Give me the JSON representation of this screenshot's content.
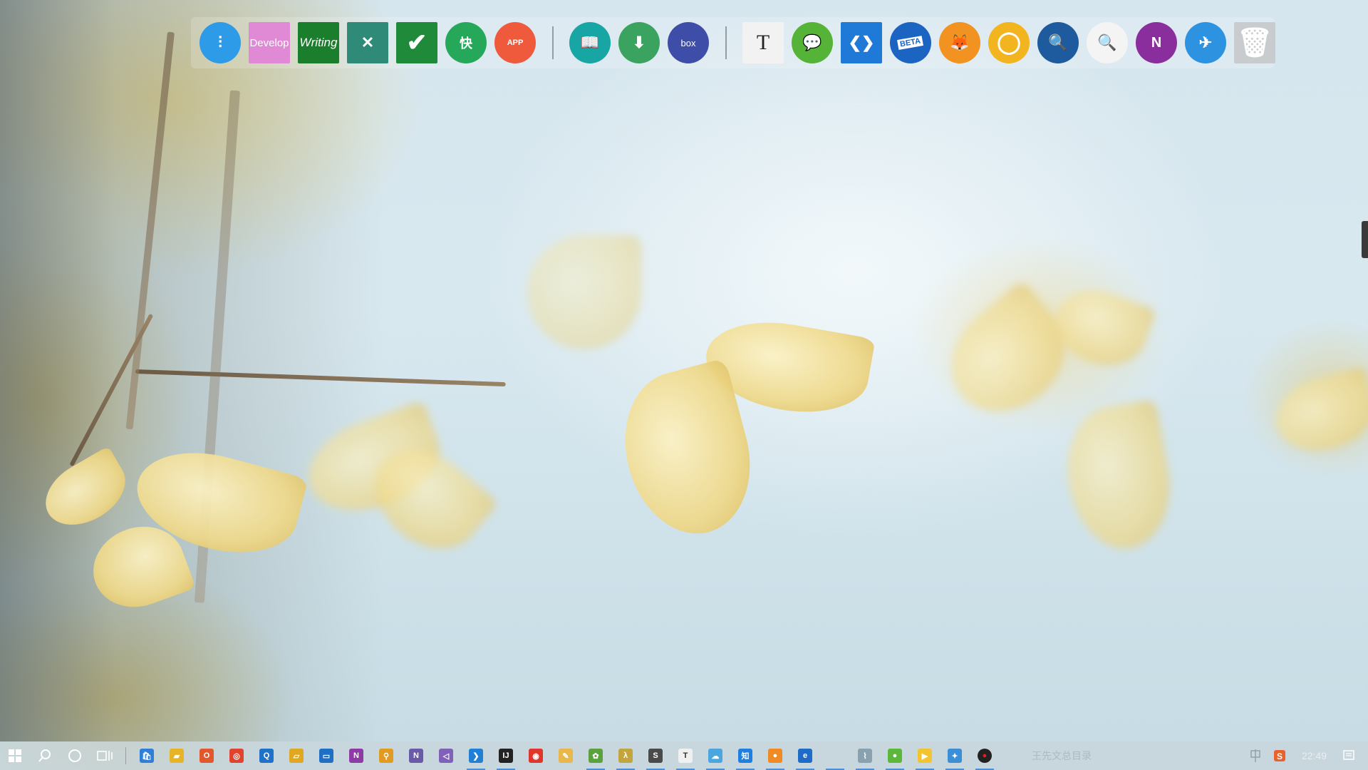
{
  "dock": {
    "items": [
      {
        "name": "mixer-app",
        "icon": "sliders-icon",
        "color": "#2e9be8",
        "shape": "circle",
        "text": ""
      },
      {
        "name": "develop-folder",
        "icon": "folder-tile",
        "color": "#e08ad6",
        "shape": "square",
        "text": "Develop"
      },
      {
        "name": "writing-folder",
        "icon": "folder-tile",
        "color": "#1b7e2c",
        "shape": "square",
        "text": "Writing"
      },
      {
        "name": "xmind-app",
        "icon": "xmind-icon",
        "color": "#2f8a78",
        "shape": "square",
        "text": ""
      },
      {
        "name": "tasks-app",
        "icon": "checkmark-icon",
        "color": "#1f8a3a",
        "shape": "square",
        "text": ""
      },
      {
        "name": "kuaijie-app",
        "icon": "kuai-icon",
        "color": "#26a85a",
        "shape": "circle",
        "text": "快"
      },
      {
        "name": "app-store",
        "icon": "app-icon",
        "color": "#ef5a3d",
        "shape": "circle",
        "text": "APP"
      },
      {
        "name": "reader-app",
        "icon": "book-icon",
        "color": "#17a6a4",
        "shape": "circle",
        "text": ""
      },
      {
        "name": "downloader-app",
        "icon": "download-icon",
        "color": "#3aa360",
        "shape": "circle",
        "text": ""
      },
      {
        "name": "box-app",
        "icon": "box-icon",
        "color": "#3d4da8",
        "shape": "circle",
        "text": "box"
      },
      {
        "name": "typora-app",
        "icon": "typora-icon",
        "color": "#f2f2f2",
        "shape": "square",
        "text": "T"
      },
      {
        "name": "wechat-app",
        "icon": "wechat-icon",
        "color": "#55b437",
        "shape": "circle",
        "text": ""
      },
      {
        "name": "vscode-app",
        "icon": "vscode-icon",
        "color": "#1e7ad6",
        "shape": "square",
        "text": ""
      },
      {
        "name": "edge-beta-app",
        "icon": "edge-beta-icon",
        "color": "#1c64c2",
        "shape": "circle",
        "text": "BETA"
      },
      {
        "name": "firefox-app",
        "icon": "firefox-icon",
        "color": "#f29321",
        "shape": "circle",
        "text": ""
      },
      {
        "name": "ring-app",
        "icon": "ring-icon",
        "color": "#f3b51f",
        "shape": "circle",
        "text": ""
      },
      {
        "name": "dictionary-app",
        "icon": "dictionary-icon",
        "color": "#1d5a9e",
        "shape": "circle",
        "text": ""
      },
      {
        "name": "search-app",
        "icon": "search-icon",
        "color": "#f4f4f4",
        "shape": "circle",
        "text": ""
      },
      {
        "name": "onenote-app",
        "icon": "onenote-icon",
        "color": "#8a2e9e",
        "shape": "circle",
        "text": "N"
      },
      {
        "name": "pin-app",
        "icon": "pin-icon",
        "color": "#2d93e0",
        "shape": "circle",
        "text": ""
      },
      {
        "name": "trash",
        "icon": "trash-icon",
        "color": "#c9ccce",
        "shape": "square",
        "text": ""
      }
    ]
  },
  "taskbar": {
    "apps": [
      {
        "name": "store",
        "icon": "store-icon",
        "color": "#2f7ed8",
        "running": false
      },
      {
        "name": "file-explorer",
        "icon": "folder-icon",
        "color": "#e6b427",
        "running": false
      },
      {
        "name": "office",
        "icon": "office-icon",
        "color": "#e2572c",
        "running": false
      },
      {
        "name": "app-red-circle",
        "icon": "swirl-icon",
        "color": "#e0442e",
        "running": false
      },
      {
        "name": "dictionary",
        "icon": "dictionary-icon",
        "color": "#1e72c8",
        "running": false
      },
      {
        "name": "sticky-app",
        "icon": "notebook-icon",
        "color": "#e0a820",
        "running": false
      },
      {
        "name": "outlook-app",
        "icon": "mail-icon",
        "color": "#1f6fc4",
        "running": false
      },
      {
        "name": "onenote",
        "icon": "onenote-icon",
        "color": "#8e3ba6",
        "running": false
      },
      {
        "name": "search-tool",
        "icon": "magnifier-icon",
        "color": "#e09b20",
        "running": false
      },
      {
        "name": "onenote-2",
        "icon": "onenote-icon",
        "color": "#6a5aa8",
        "running": false
      },
      {
        "name": "visual-studio",
        "icon": "vs-icon",
        "color": "#7f62b8",
        "running": false
      },
      {
        "name": "vscode",
        "icon": "vscode-icon",
        "color": "#1f80d6",
        "running": true
      },
      {
        "name": "intellij",
        "icon": "ij-icon",
        "color": "#222222",
        "running": true
      },
      {
        "name": "weibo",
        "icon": "weibo-icon",
        "color": "#e0352b",
        "running": false
      },
      {
        "name": "painter",
        "icon": "paint-icon",
        "color": "#e8b84a",
        "running": false
      },
      {
        "name": "clover-app",
        "icon": "clover-icon",
        "color": "#5aa33c",
        "running": true
      },
      {
        "name": "lambda-app",
        "icon": "lambda-icon",
        "color": "#c2a53c",
        "running": true
      },
      {
        "name": "sublime",
        "icon": "sublime-icon",
        "color": "#4a4a4a",
        "running": true
      },
      {
        "name": "typora",
        "icon": "typora-icon",
        "color": "#f0f0f0",
        "running": true
      },
      {
        "name": "cloud-app",
        "icon": "cloud-icon",
        "color": "#4aa6df",
        "running": true
      },
      {
        "name": "zhihu",
        "icon": "zhihu-icon",
        "color": "#1f7fe0",
        "running": true
      },
      {
        "name": "firefox",
        "icon": "firefox-icon",
        "color": "#f08a24",
        "running": true
      },
      {
        "name": "edge-beta",
        "icon": "edge-icon",
        "color": "#1e6cc8",
        "running": true
      },
      {
        "name": "blank-app",
        "icon": "blank-icon",
        "color": "transparent",
        "running": true
      },
      {
        "name": "chart-app",
        "icon": "chart-icon",
        "color": "#8aa2b0",
        "running": true
      },
      {
        "name": "wechat",
        "icon": "wechat-icon",
        "color": "#5bb83a",
        "running": true
      },
      {
        "name": "player",
        "icon": "player-icon",
        "color": "#f2c530",
        "running": true
      },
      {
        "name": "pin-tool",
        "icon": "pin-icon",
        "color": "#3a8fd6",
        "running": true
      },
      {
        "name": "recorder",
        "icon": "record-icon",
        "color": "#c0281e",
        "running": true
      }
    ],
    "faded_title": "王先文总目录",
    "clock": "22:49"
  },
  "colors": {
    "taskbar_bg": "#c8d6dc",
    "running_indicator": "#4a90d9"
  }
}
